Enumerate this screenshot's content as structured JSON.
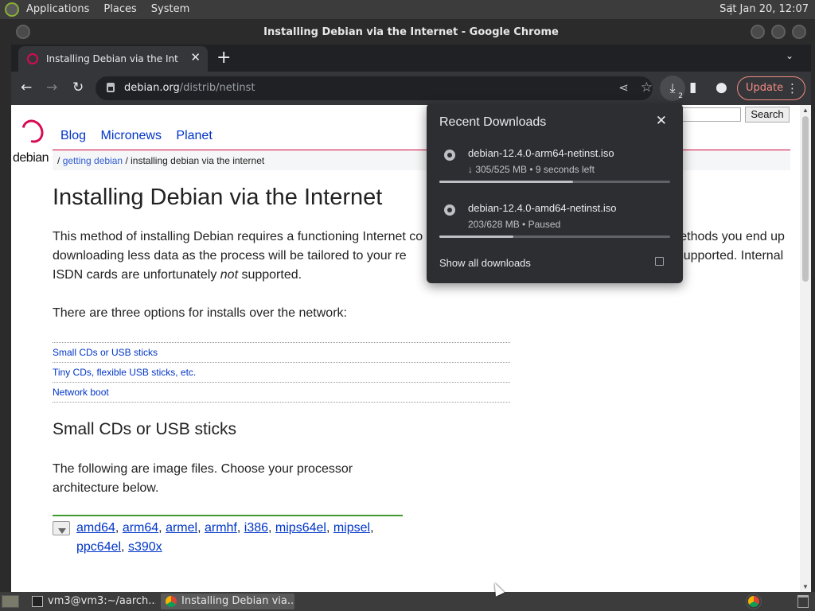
{
  "panel": {
    "menus": [
      "Applications",
      "Places",
      "System"
    ],
    "clock": "Sat Jan 20, 12:07"
  },
  "window": {
    "title": "Installing Debian via the Internet - Google Chrome"
  },
  "tab": {
    "title": "Installing Debian via the Internet",
    "close_icon": "✕",
    "newtab_icon": "+",
    "tablist_icon": "⌄"
  },
  "toolbar": {
    "back_icon": "←",
    "forward_icon": "→",
    "reload_icon": "↻",
    "url_host": "debian.org",
    "url_path": "/distrib/netinst",
    "share_icon": "⋖",
    "star_icon": "☆",
    "download_icon": "⤓",
    "download_count": "2",
    "sidepanel_icon": "▮",
    "profile_icon": "●",
    "update_label": "Update",
    "menu_icon": "⋮"
  },
  "site": {
    "logo_word": "debian",
    "nav": [
      "Blog",
      "Micronews",
      "Planet"
    ],
    "search_label": "Search",
    "breadcrumb": {
      "separator": "/",
      "link": "getting debian",
      "current": "installing debian via the internet"
    }
  },
  "content": {
    "title": "Installing Debian via the Internet",
    "intro_part1": "This method of installing Debian requires a functioning Internet co",
    "intro_part2": "r methods you end up downloading less data as the process will be tailored to your re",
    "intro_part3": "s are supported. Internal ISDN cards are unfortunately ",
    "intro_em": "not",
    "intro_part4": " supported.",
    "options_intro": "There are three options for installs over the network:",
    "toc": [
      "Small CDs or USB sticks",
      "Tiny CDs, flexible USB sticks, etc.",
      "Network boot"
    ],
    "small_title": "Small CDs or USB sticks",
    "files_intro": "The following are image files. Choose your processor architecture below.",
    "architectures": [
      "amd64",
      "arm64",
      "armel",
      "armhf",
      "i386",
      "mips64el",
      "mipsel",
      "ppc64el",
      "s390x"
    ]
  },
  "downloads": {
    "heading": "Recent Downloads",
    "close_icon": "✕",
    "items": [
      {
        "name": "debian-12.4.0-arm64-netinst.iso",
        "status": "↓ 305/525 MB • 9 seconds left",
        "progress": 0.58
      },
      {
        "name": "debian-12.4.0-amd64-netinst.iso",
        "status": "203/628 MB • Paused",
        "progress": 0.32
      }
    ],
    "show_all": "Show all downloads"
  },
  "taskbar": {
    "tasks": [
      "vm3@vm3:~/aarch...",
      "Installing Debian via..."
    ]
  },
  "colors": {
    "debian_red": "#d70a53",
    "link_blue": "#0035c7",
    "update_accent": "#f28b82",
    "arch_rule": "#3f9a2f"
  }
}
